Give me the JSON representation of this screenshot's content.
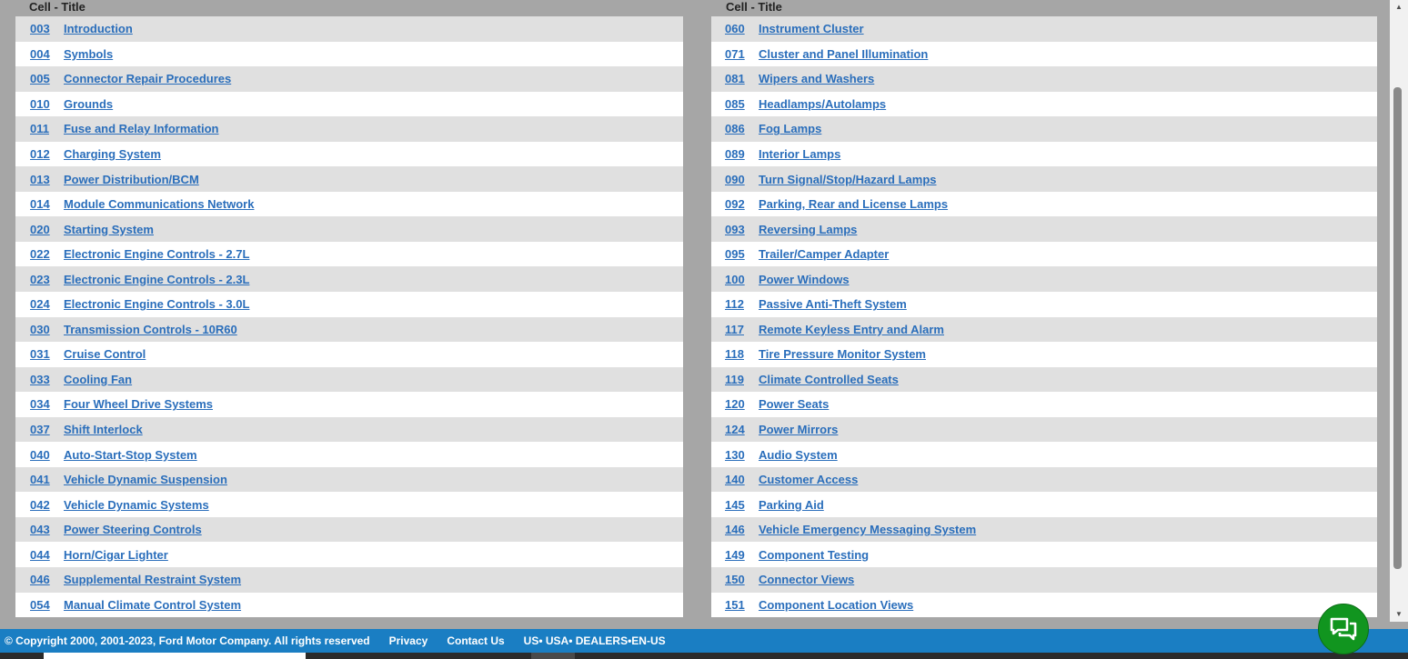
{
  "columns": {
    "left_header": "Cell - Title",
    "right_header": "Cell - Title"
  },
  "left_rows": [
    {
      "code": "003",
      "title": "Introduction"
    },
    {
      "code": "004",
      "title": "Symbols"
    },
    {
      "code": "005",
      "title": "Connector Repair Procedures"
    },
    {
      "code": "010",
      "title": "Grounds"
    },
    {
      "code": "011",
      "title": "Fuse and Relay Information"
    },
    {
      "code": "012",
      "title": "Charging System"
    },
    {
      "code": "013",
      "title": "Power Distribution/BCM"
    },
    {
      "code": "014",
      "title": "Module Communications Network"
    },
    {
      "code": "020",
      "title": "Starting System"
    },
    {
      "code": "022",
      "title": "Electronic Engine Controls - 2.7L"
    },
    {
      "code": "023",
      "title": "Electronic Engine Controls - 2.3L"
    },
    {
      "code": "024",
      "title": "Electronic Engine Controls - 3.0L"
    },
    {
      "code": "030",
      "title": "Transmission Controls - 10R60"
    },
    {
      "code": "031",
      "title": "Cruise Control"
    },
    {
      "code": "033",
      "title": "Cooling Fan"
    },
    {
      "code": "034",
      "title": "Four Wheel Drive Systems"
    },
    {
      "code": "037",
      "title": "Shift Interlock"
    },
    {
      "code": "040",
      "title": "Auto-Start-Stop System"
    },
    {
      "code": "041",
      "title": "Vehicle Dynamic Suspension"
    },
    {
      "code": "042",
      "title": "Vehicle Dynamic Systems"
    },
    {
      "code": "043",
      "title": "Power Steering Controls"
    },
    {
      "code": "044",
      "title": "Horn/Cigar Lighter"
    },
    {
      "code": "046",
      "title": "Supplemental Restraint System"
    },
    {
      "code": "054",
      "title": "Manual Climate Control System"
    }
  ],
  "right_rows": [
    {
      "code": "060",
      "title": "Instrument Cluster"
    },
    {
      "code": "071",
      "title": "Cluster and Panel Illumination"
    },
    {
      "code": "081",
      "title": "Wipers and Washers"
    },
    {
      "code": "085",
      "title": "Headlamps/Autolamps"
    },
    {
      "code": "086",
      "title": "Fog Lamps"
    },
    {
      "code": "089",
      "title": "Interior Lamps"
    },
    {
      "code": "090",
      "title": "Turn Signal/Stop/Hazard Lamps"
    },
    {
      "code": "092",
      "title": "Parking, Rear and License Lamps"
    },
    {
      "code": "093",
      "title": "Reversing Lamps"
    },
    {
      "code": "095",
      "title": "Trailer/Camper Adapter"
    },
    {
      "code": "100",
      "title": "Power Windows"
    },
    {
      "code": "112",
      "title": "Passive Anti-Theft System"
    },
    {
      "code": "117",
      "title": "Remote Keyless Entry and Alarm"
    },
    {
      "code": "118",
      "title": "Tire Pressure Monitor System"
    },
    {
      "code": "119",
      "title": "Climate Controlled Seats"
    },
    {
      "code": "120",
      "title": "Power Seats"
    },
    {
      "code": "124",
      "title": "Power Mirrors"
    },
    {
      "code": "130",
      "title": "Audio System"
    },
    {
      "code": "140",
      "title": "Customer Access"
    },
    {
      "code": "145",
      "title": "Parking Aid"
    },
    {
      "code": "146",
      "title": "Vehicle Emergency Messaging System"
    },
    {
      "code": "149",
      "title": "Component Testing"
    },
    {
      "code": "150",
      "title": "Connector Views"
    },
    {
      "code": "151",
      "title": "Component Location Views"
    }
  ],
  "footer": {
    "copyright": "© Copyright 2000, 2001-2023, Ford Motor Company. All rights reserved",
    "privacy": "Privacy",
    "contact": "Contact Us",
    "region": "US• USA• DEALERS•EN-US"
  },
  "icons": {
    "chat": "chat-bubbles-icon",
    "scroll_up": "arrow-up-icon",
    "scroll_down": "arrow-down-icon"
  },
  "colors": {
    "link": "#2a6ebb",
    "footer_bg": "#1a7ec3",
    "chat_bg": "#11951f"
  }
}
